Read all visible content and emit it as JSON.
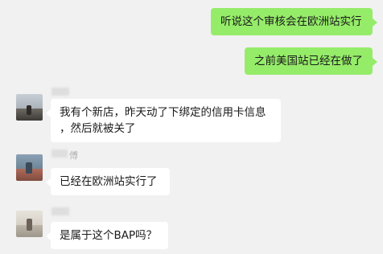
{
  "messages": [
    {
      "side": "outgoing",
      "text": "听说这个审核会在欧洲站实行"
    },
    {
      "side": "outgoing",
      "text": "之前美国站已经在做了"
    },
    {
      "side": "incoming",
      "nickname": "",
      "lines": [
        "我有个新店，昨天动了下绑定的信用卡信息",
        "，然后就被关了"
      ],
      "avatar": "user-avatar-1"
    },
    {
      "side": "incoming",
      "nickname": "傅",
      "text": "已经在欧洲站实行了",
      "avatar": "user-avatar-2"
    },
    {
      "side": "incoming",
      "nickname": "",
      "text": "是属于这个BAP吗？",
      "avatar": "user-avatar-3"
    }
  ],
  "colors": {
    "background": "#f1f1f1",
    "outgoing_bubble": "#95ec69",
    "incoming_bubble": "#ffffff",
    "nickname": "#aaaaaa"
  }
}
